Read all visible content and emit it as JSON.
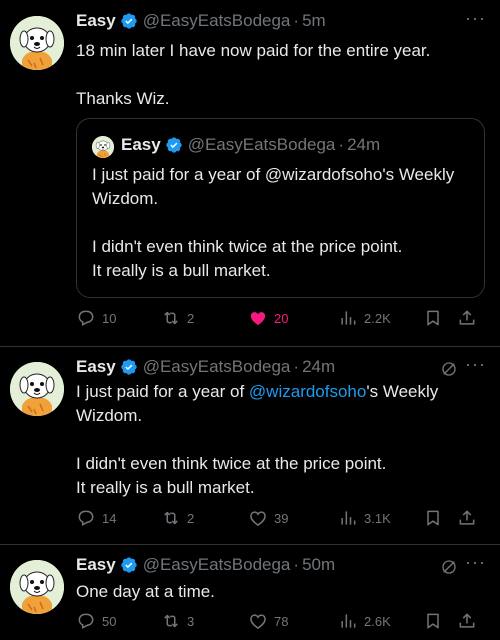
{
  "tweets": [
    {
      "name": "Easy",
      "handle": "@EasyEatsBodega",
      "dot": "·",
      "time": "5m",
      "text": "18 min later I have now paid for the entire year.\n\nThanks Wiz.",
      "more": "···",
      "quote": {
        "name": "Easy",
        "handle": "@EasyEatsBodega",
        "dot": "·",
        "time": "24m",
        "text": "I just paid for a year of @wizardofsoho's Weekly Wizdom.\n\nI didn't even think twice at the price point.\nIt really is a bull market."
      },
      "replies": "10",
      "reposts": "2",
      "likes": "20",
      "views": "2.2K",
      "liked": true
    },
    {
      "name": "Easy",
      "handle": "@EasyEatsBodega",
      "dot": "·",
      "time": "24m",
      "text_pre": "I just paid for a year of ",
      "mention": "@wizardofsoho",
      "text_post": "'s Weekly Wizdom.\n\nI didn't even think twice at the price point.\nIt really is a bull market.",
      "more": "···",
      "replies": "14",
      "reposts": "2",
      "likes": "39",
      "views": "3.1K"
    },
    {
      "name": "Easy",
      "handle": "@EasyEatsBodega",
      "dot": "·",
      "time": "50m",
      "text": "One day at a time.",
      "more": "···",
      "replies": "50",
      "reposts": "3",
      "likes": "78",
      "views": "2.6K"
    }
  ],
  "colors": {
    "accent": "#1d9bf0",
    "like": "#f91880",
    "muted": "#71767b",
    "text": "#e7e9ea"
  },
  "icons": [
    "verified-badge-icon",
    "reply-icon",
    "repost-icon",
    "like-icon",
    "views-icon",
    "bookmark-icon",
    "share-icon",
    "grok-icon",
    "more-icon"
  ]
}
